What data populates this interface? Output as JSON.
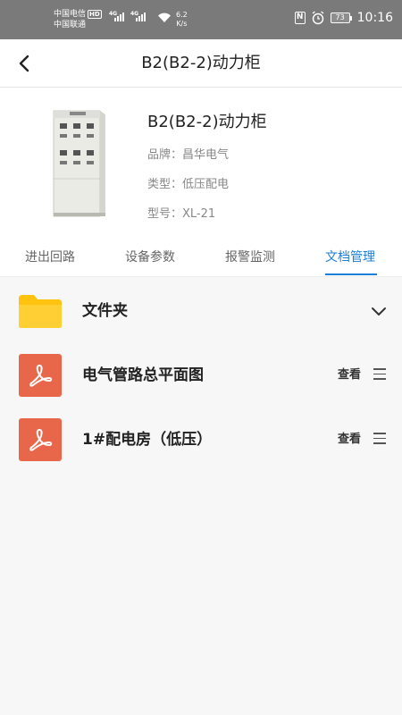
{
  "status_bar": {
    "carrier1": "中国电信",
    "hd": "HD",
    "carrier2": "中国联通",
    "net1": "4G",
    "net2": "4G",
    "speed_value": "6.2",
    "speed_unit": "K/s",
    "battery": "73",
    "time": "10:16",
    "nfc": "N",
    "icons": [
      "signal-icon",
      "wifi-icon",
      "nfc-icon",
      "alarm-icon",
      "battery-icon"
    ]
  },
  "header": {
    "title": "B2(B2-2)动力柜",
    "back_icon": "back-arrow-icon"
  },
  "device": {
    "name": "B2(B2-2)动力柜",
    "brand_label": "品牌：",
    "brand_value": "昌华电气",
    "type_label": "类型：",
    "type_value": "低压配电",
    "model_label": "型号：",
    "model_value": "XL-21",
    "image": "cabinet-image"
  },
  "tabs": [
    {
      "label": "进出回路",
      "active": false
    },
    {
      "label": "设备参数",
      "active": false
    },
    {
      "label": "报警监测",
      "active": false
    },
    {
      "label": "文档管理",
      "active": true
    }
  ],
  "colors": {
    "accent": "#1a7fd6",
    "folder": "#ffc20e",
    "pdf": "#e8664a",
    "status_bar": "#7a7a7a"
  },
  "documents": {
    "folder_label": "文件夹",
    "files": [
      {
        "name": "电气管路总平面图",
        "view_label": "查看",
        "icon": "pdf-icon"
      },
      {
        "name": "1#配电房（低压）",
        "view_label": "查看",
        "icon": "pdf-icon"
      }
    ]
  }
}
